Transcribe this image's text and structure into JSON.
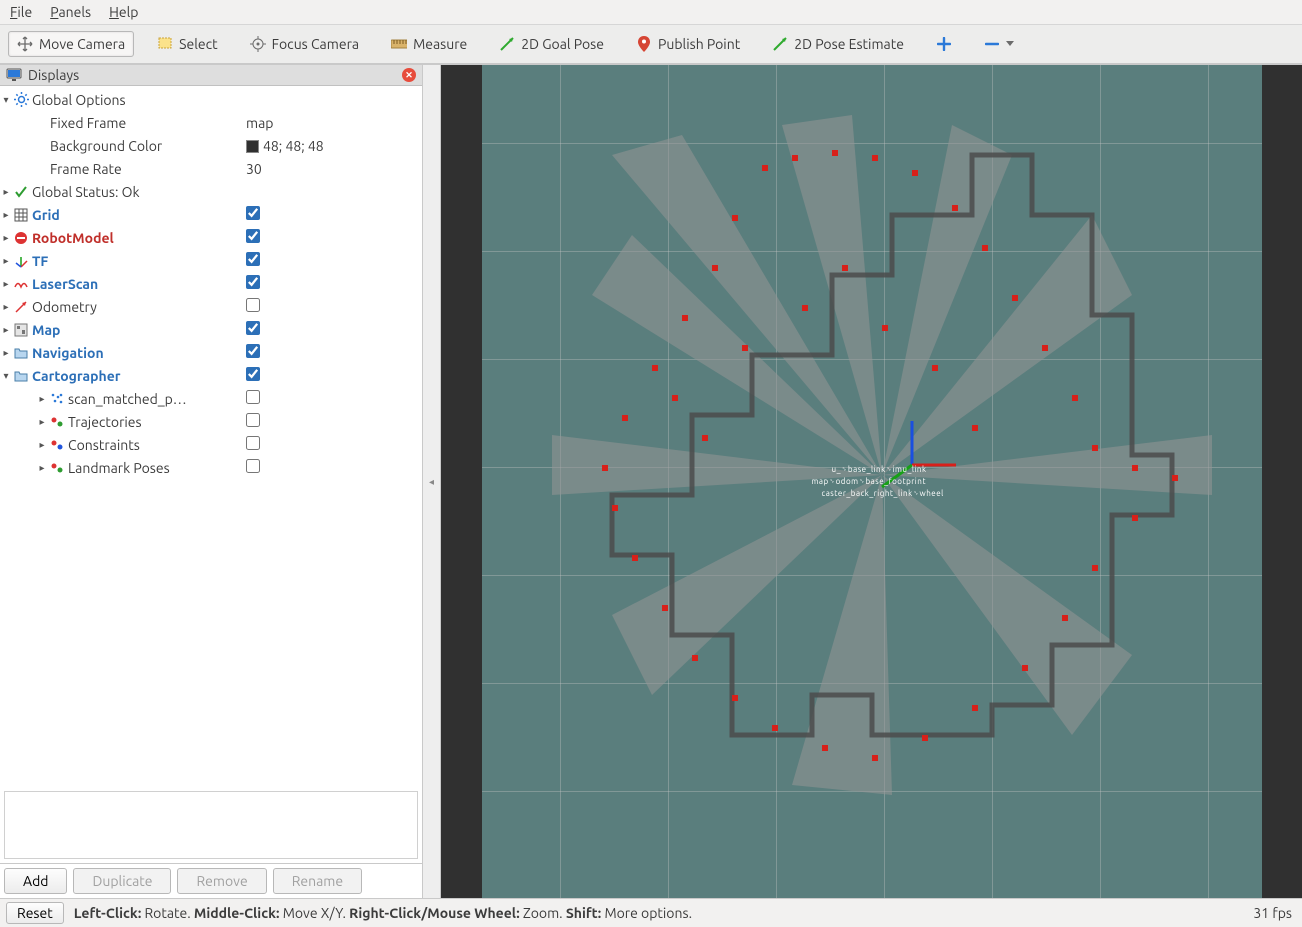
{
  "menu": {
    "file": "File",
    "panels": "Panels",
    "help": "Help"
  },
  "toolbar": {
    "move_camera": "Move Camera",
    "select": "Select",
    "focus_camera": "Focus Camera",
    "measure": "Measure",
    "goal_pose": "2D Goal Pose",
    "publish_point": "Publish Point",
    "pose_estimate": "2D Pose Estimate"
  },
  "panel": {
    "title": "Displays",
    "global_options": "Global Options",
    "fixed_frame_label": "Fixed Frame",
    "fixed_frame_value": "map",
    "bg_color_label": "Background Color",
    "bg_color_value": "48; 48; 48",
    "frame_rate_label": "Frame Rate",
    "frame_rate_value": "30",
    "global_status": "Global Status: Ok",
    "items": {
      "grid": "Grid",
      "robot_model": "RobotModel",
      "tf": "TF",
      "laserscan": "LaserScan",
      "odometry": "Odometry",
      "map": "Map",
      "navigation": "Navigation",
      "cartographer": "Cartographer",
      "scan_matched": "scan_matched_p…",
      "trajectories": "Trajectories",
      "constraints": "Constraints",
      "landmark_poses": "Landmark Poses"
    },
    "checks": {
      "grid": true,
      "robot_model": true,
      "tf": true,
      "laserscan": true,
      "odometry": false,
      "map": true,
      "navigation": true,
      "cartographer": true,
      "scan_matched": false,
      "trajectories": false,
      "constraints": false,
      "landmark_poses": false
    },
    "buttons": {
      "add": "Add",
      "duplicate": "Duplicate",
      "remove": "Remove",
      "rename": "Rename"
    }
  },
  "status": {
    "reset": "Reset",
    "hints_html": "Left-Click:|Rotate.|Middle-Click:|Move X/Y.|Right-Click/Mouse Wheel:|Zoom.|Shift:|More options.",
    "fps": "31 fps"
  }
}
